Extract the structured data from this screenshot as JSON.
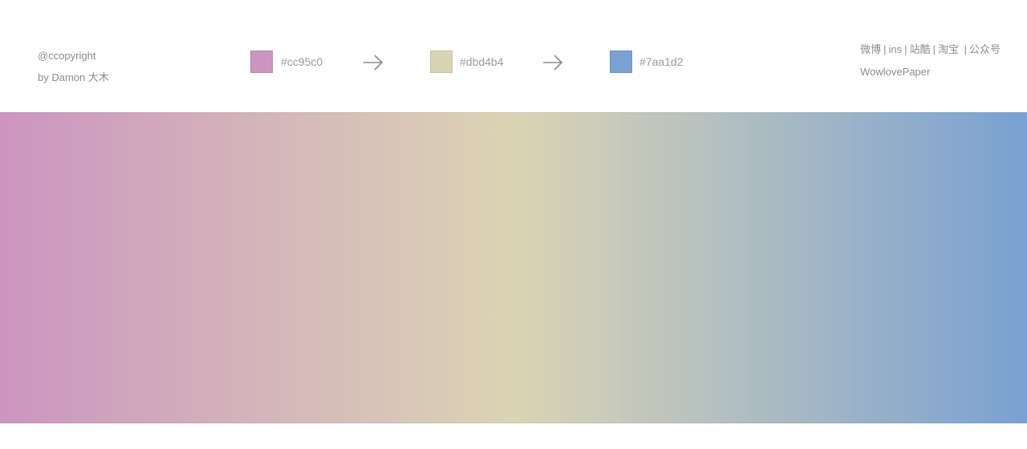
{
  "credit": {
    "line1": "@ccopyright",
    "line2": "by Damon 大木"
  },
  "palette": {
    "color1": "#cc95c0",
    "color2": "#dbd4b4",
    "color3": "#7aa1d2",
    "label1": "#cc95c0",
    "label2": "#dbd4b4",
    "label3": "#7aa1d2"
  },
  "social": {
    "links": [
      "微博",
      "ins",
      "站酷",
      "淘宝",
      "公众号"
    ],
    "brand": "WowlovePaper"
  },
  "icons": {
    "arrow": "arrow-right-icon"
  }
}
